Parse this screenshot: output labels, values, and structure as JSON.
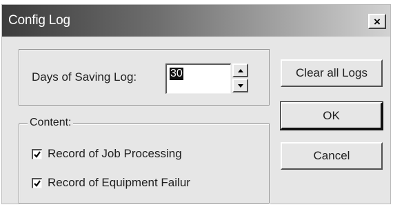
{
  "window": {
    "title": "Config Log",
    "close_symbol": "×"
  },
  "days_group": {
    "label": "Days of Saving Log:",
    "value": "30"
  },
  "content_group": {
    "legend": "Content:",
    "items": [
      {
        "label": "Record of Job Processing",
        "checked": true
      },
      {
        "label": "Record of Equipment Failur",
        "checked": true
      }
    ]
  },
  "buttons": {
    "clear_all": "Clear all Logs",
    "ok": "OK",
    "cancel": "Cancel"
  },
  "icons": {
    "close": "close-icon",
    "spin_up": "up-arrow-icon",
    "spin_down": "down-arrow-icon",
    "check": "checkmark-icon"
  }
}
